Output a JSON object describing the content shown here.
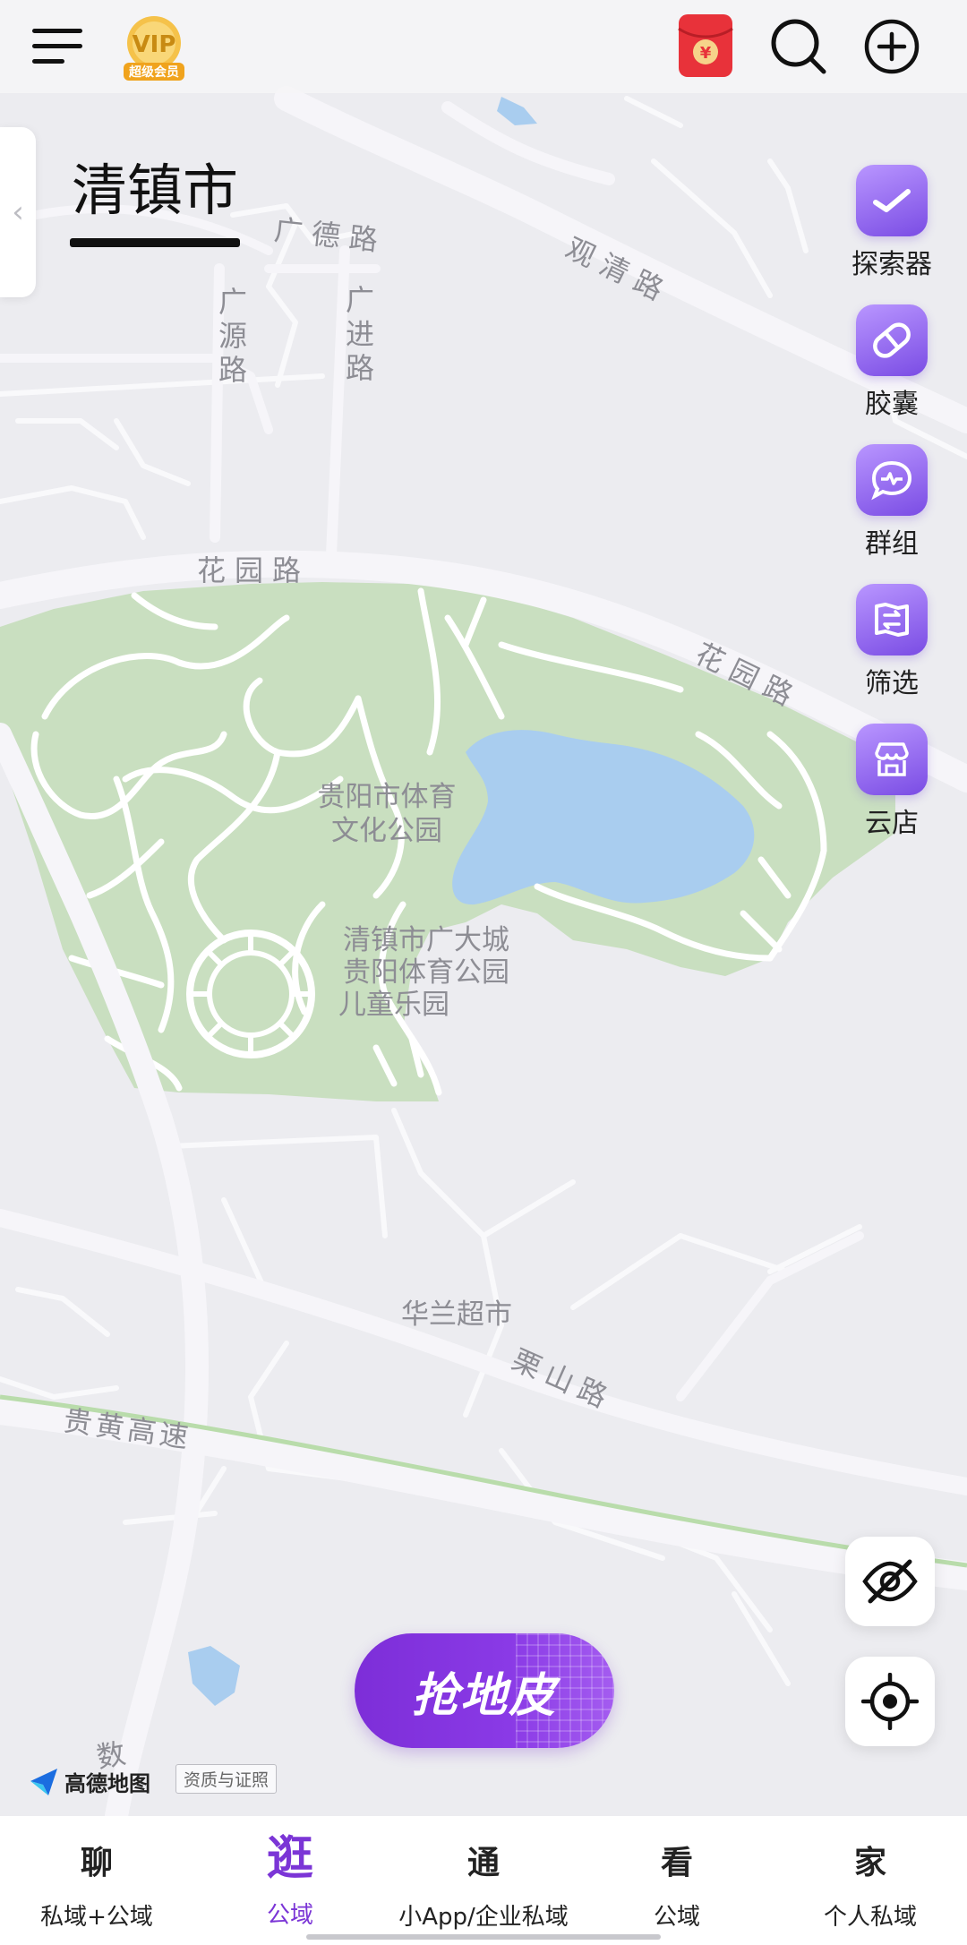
{
  "header": {
    "city": "清镇市",
    "vip_badge_text": "超级会员",
    "vip_badge_letter": "VIP",
    "icons": [
      "menu-icon",
      "vip-badge-icon",
      "red-envelope-icon",
      "search-icon",
      "add-circle-icon"
    ]
  },
  "map": {
    "roads": [
      "广德路",
      "观清路",
      "广源路",
      "广进路",
      "花园路",
      "花园路",
      "贵黄高速",
      "栗山路",
      "数"
    ],
    "places": {
      "park": [
        "贵阳市体育",
        "文化公园"
      ],
      "playground": [
        "清镇市广大城",
        "贵阳体育公园",
        "儿童乐园"
      ],
      "market": "华兰超市"
    },
    "provider": "高德地图",
    "license": "资质与证照"
  },
  "tools": [
    {
      "label": "探索器",
      "icon": "explorer-icon"
    },
    {
      "label": "胶囊",
      "icon": "capsule-icon"
    },
    {
      "label": "群组",
      "icon": "group-chat-icon"
    },
    {
      "label": "筛选",
      "icon": "filter-icon"
    },
    {
      "label": "云店",
      "icon": "cloud-store-icon"
    }
  ],
  "controls": {
    "hide_icon": "eye-off-icon",
    "locate_icon": "locate-icon",
    "grab_button": "抢地皮"
  },
  "nav": [
    {
      "main": "聊",
      "sub": "私域+公域"
    },
    {
      "main": "逛",
      "sub": "公域"
    },
    {
      "main": "通",
      "sub": "小App/企业私域"
    },
    {
      "main": "看",
      "sub": "公域"
    },
    {
      "main": "家",
      "sub": "个人私域"
    }
  ],
  "active_nav_index": 1,
  "colors": {
    "accent": "#7b35d6",
    "park": "#c9dfc0",
    "water": "#a9cdef",
    "map_bg": "#ececf0",
    "road": "#ffffff"
  }
}
